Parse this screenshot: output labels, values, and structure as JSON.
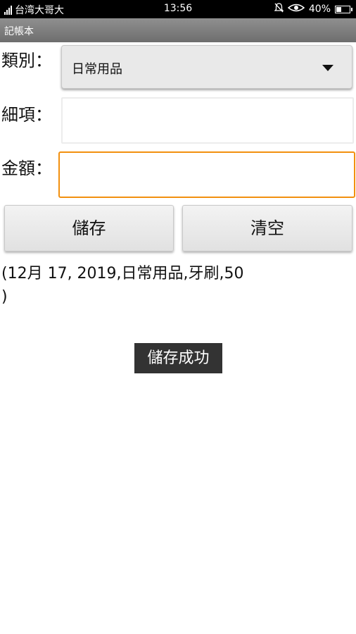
{
  "status_bar": {
    "carrier": "台湾大哥大",
    "time": "13:56",
    "battery_percent": "40%",
    "battery_level": 0.4,
    "icons": [
      "signal-icon",
      "alarm-icon",
      "eye-icon",
      "battery-icon"
    ]
  },
  "app": {
    "title": "記帳本"
  },
  "form": {
    "category_label": "類別：",
    "category_value": "日常用品",
    "detail_label": "細項：",
    "detail_value": "",
    "amount_label": "金額：",
    "amount_value": ""
  },
  "buttons": {
    "save": "儲存",
    "clear": "清空"
  },
  "record_text": "(12月 17, 2019,日常用品,牙刷,50\n)",
  "toast": "儲存成功",
  "colors": {
    "focus_border": "#f2900f",
    "title_bar": "#7a7a7a",
    "toast_bg": "#333333"
  }
}
